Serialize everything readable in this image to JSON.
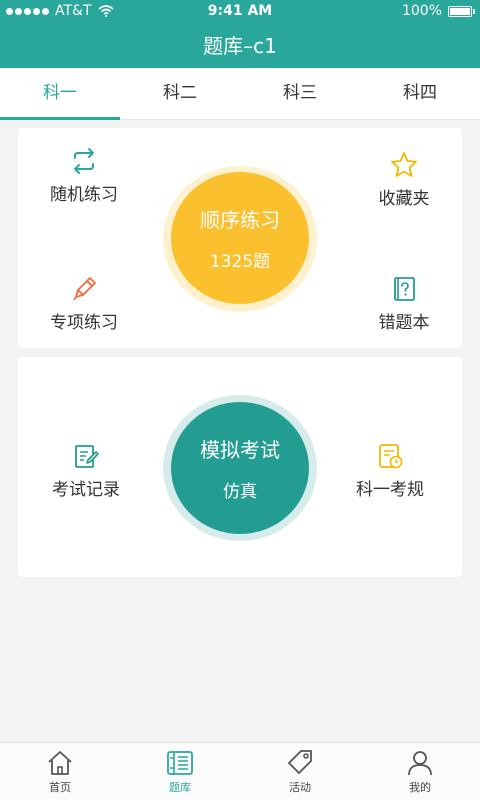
{
  "status": {
    "carrier": "AT&T",
    "time": "9:41 AM",
    "battery": "100%"
  },
  "header": {
    "title": "题库–c1"
  },
  "tabs": [
    {
      "label": "科一"
    },
    {
      "label": "科二"
    },
    {
      "label": "科三"
    },
    {
      "label": "科四"
    }
  ],
  "card1": {
    "random": "随机练习",
    "favorites": "收藏夹",
    "special": "专项练习",
    "wrongbook": "错题本",
    "center_title": "顺序练习",
    "center_count": "1325题"
  },
  "card2": {
    "records": "考试记录",
    "rules": "科一考规",
    "center_title": "模拟考试",
    "center_sub": "仿真"
  },
  "bottom": [
    {
      "label": "首页"
    },
    {
      "label": "题库"
    },
    {
      "label": "活动"
    },
    {
      "label": "我的"
    }
  ],
  "colors": {
    "accent": "#2aa79b",
    "yellow": "#fbc02d",
    "orange": "#f26b3a"
  }
}
